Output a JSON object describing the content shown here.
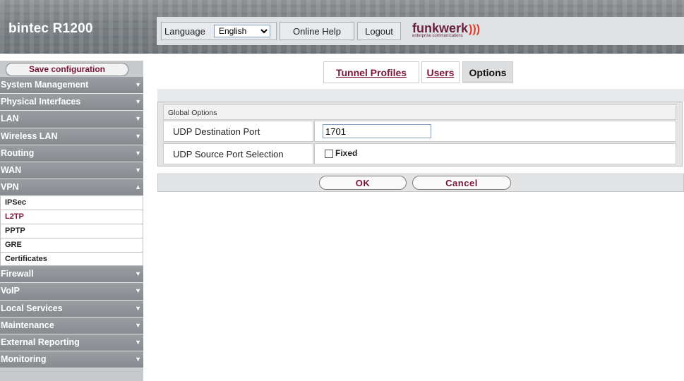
{
  "header": {
    "brand": "bintec R1200",
    "language_label": "Language",
    "language_value": "English",
    "online_help": "Online Help",
    "logout": "Logout",
    "logo_text": "funkwerk",
    "logo_sub": "enterprise communications"
  },
  "sidebar": {
    "save_label": "Save configuration",
    "items": [
      {
        "label": "System Management"
      },
      {
        "label": "Physical Interfaces"
      },
      {
        "label": "LAN"
      },
      {
        "label": "Wireless LAN"
      },
      {
        "label": "Routing"
      },
      {
        "label": "WAN"
      },
      {
        "label": "VPN"
      },
      {
        "label": "Firewall"
      },
      {
        "label": "VoIP"
      },
      {
        "label": "Local Services"
      },
      {
        "label": "Maintenance"
      },
      {
        "label": "External Reporting"
      },
      {
        "label": "Monitoring"
      }
    ],
    "vpn_sub": [
      "IPSec",
      "L2TP",
      "PPTP",
      "GRE",
      "Certificates"
    ],
    "active_sub": "L2TP"
  },
  "tabs": [
    "Tunnel Profiles",
    "Users",
    "Options"
  ],
  "active_tab": "Options",
  "form": {
    "section_title": "Global Options",
    "udp_dest_label": "UDP Destination Port",
    "udp_dest_value": "1701",
    "udp_src_label": "UDP Source Port Selection",
    "fixed_label": "Fixed",
    "fixed_checked": false
  },
  "buttons": {
    "ok": "OK",
    "cancel": "Cancel"
  },
  "colors": {
    "accent": "#7a1436",
    "sidebar_item": "#878b8f",
    "header_bg": "#7a8084"
  }
}
